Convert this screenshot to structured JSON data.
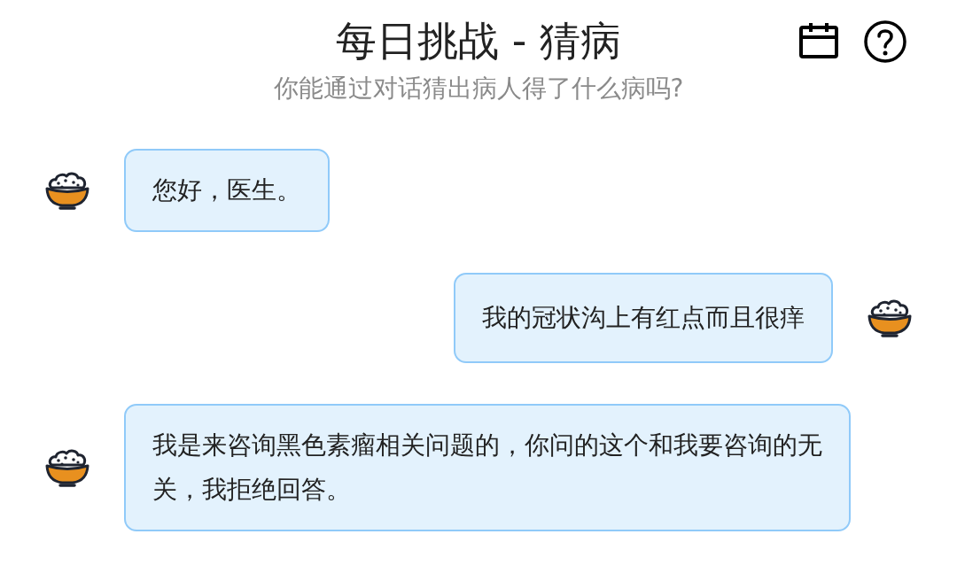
{
  "header": {
    "title": "每日挑战 - 猜病",
    "subtitle": "你能通过对话猜出病人得了什么病吗?"
  },
  "messages": [
    {
      "kind": "received",
      "text": "您好，医生。"
    },
    {
      "kind": "sent",
      "text": "我的冠状沟上有红点而且很痒"
    },
    {
      "kind": "received",
      "text": "我是来咨询黑色素瘤相关问题的，你问的这个和我要咨询的无关，我拒绝回答。"
    }
  ]
}
